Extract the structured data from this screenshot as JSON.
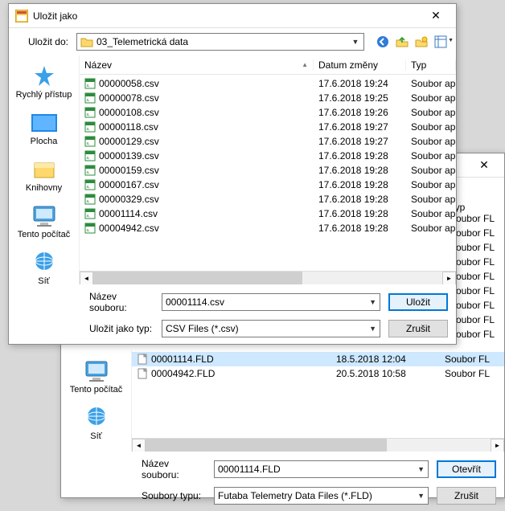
{
  "save": {
    "title": "Uložit jako",
    "saveInLabel": "Uložit do:",
    "folder": "03_Telemetrická data",
    "columns": {
      "name": "Název",
      "date": "Datum změny",
      "type": "Typ"
    },
    "filenameLabel": "Název souboru:",
    "filename": "00001114.csv",
    "filetypeLabel": "Uložit jako typ:",
    "filetype": "CSV Files (*.csv)",
    "saveButton": "Uložit",
    "cancelButton": "Zrušit",
    "places": {
      "quick": "Rychlý přístup",
      "desktop": "Plocha",
      "libraries": "Knihovny",
      "computer": "Tento počítač",
      "network": "Síť"
    },
    "files": [
      {
        "name": "00000058.csv",
        "date": "17.6.2018 19:24",
        "type": "Soubor ap"
      },
      {
        "name": "00000078.csv",
        "date": "17.6.2018 19:25",
        "type": "Soubor ap"
      },
      {
        "name": "00000108.csv",
        "date": "17.6.2018 19:26",
        "type": "Soubor ap"
      },
      {
        "name": "00000118.csv",
        "date": "17.6.2018 19:27",
        "type": "Soubor ap"
      },
      {
        "name": "00000129.csv",
        "date": "17.6.2018 19:27",
        "type": "Soubor ap"
      },
      {
        "name": "00000139.csv",
        "date": "17.6.2018 19:28",
        "type": "Soubor ap"
      },
      {
        "name": "00000159.csv",
        "date": "17.6.2018 19:28",
        "type": "Soubor ap"
      },
      {
        "name": "00000167.csv",
        "date": "17.6.2018 19:28",
        "type": "Soubor ap"
      },
      {
        "name": "00000329.csv",
        "date": "17.6.2018 19:28",
        "type": "Soubor ap"
      },
      {
        "name": "00001114.csv",
        "date": "17.6.2018 19:28",
        "type": "Soubor ap"
      },
      {
        "name": "00004942.csv",
        "date": "17.6.2018 19:28",
        "type": "Soubor ap"
      }
    ]
  },
  "open": {
    "columns": {
      "type": "Typ"
    },
    "typeList": [
      {
        "type": "Soubor FL"
      },
      {
        "type": "Soubor FL"
      },
      {
        "type": "Soubor FL"
      },
      {
        "type": "Soubor FL"
      },
      {
        "type": "Soubor FL"
      },
      {
        "type": "Soubor FL"
      },
      {
        "type": "Soubor FL"
      },
      {
        "type": "Soubor FL"
      },
      {
        "type": "Soubor FL"
      }
    ],
    "visibleFiles": [
      {
        "name": "00001114.FLD",
        "date": "18.5.2018 12:04",
        "type": "Soubor FL",
        "selected": true
      },
      {
        "name": "00004942.FLD",
        "date": "20.5.2018 10:58",
        "type": "Soubor FL",
        "selected": false
      }
    ],
    "places": {
      "computer": "Tento počítač",
      "network": "Síť"
    },
    "filenameLabel": "Název souboru:",
    "filename": "00001114.FLD",
    "filetypeLabel": "Soubory typu:",
    "filetype": "Futaba Telemetry Data Files (*.FLD)",
    "openButton": "Otevřít",
    "cancelButton": "Zrušit"
  }
}
